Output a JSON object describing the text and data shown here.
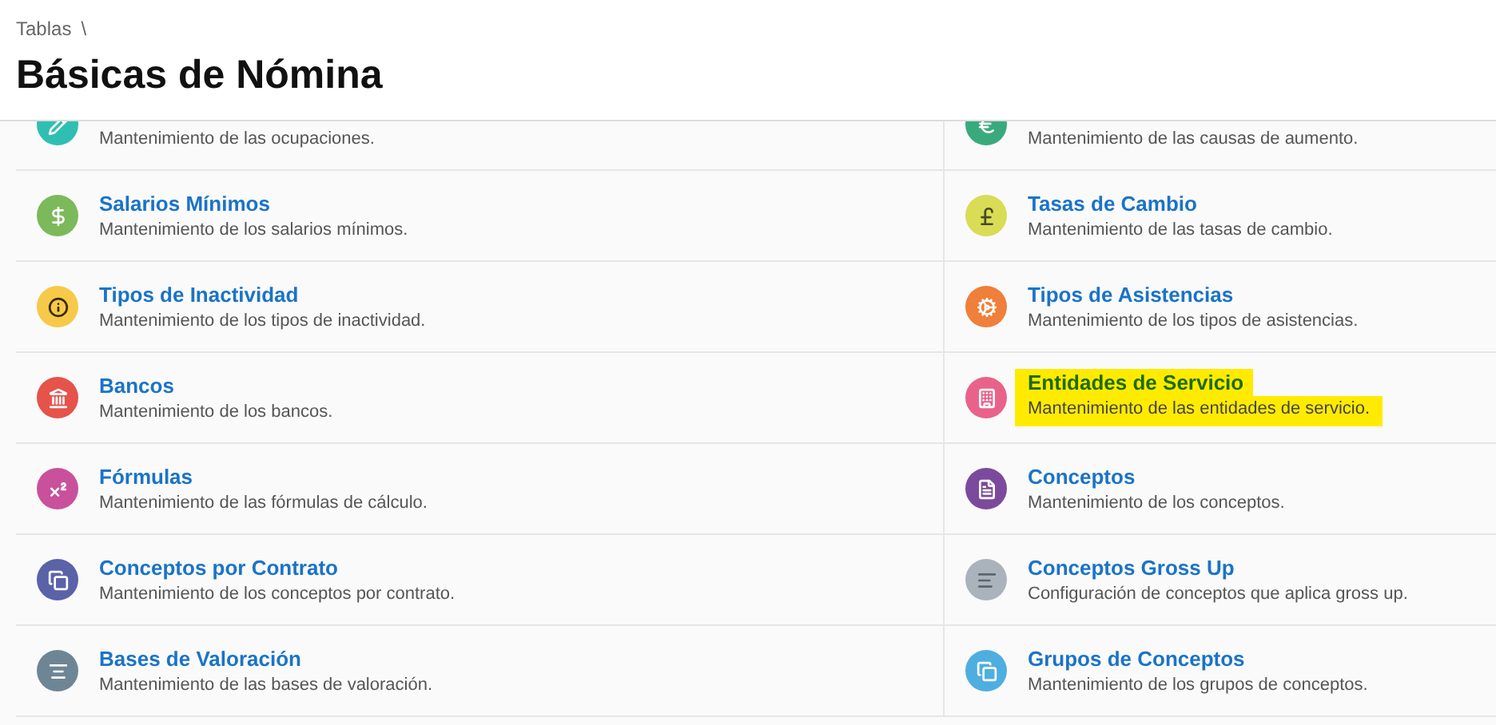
{
  "breadcrumb": {
    "items": [
      "Tablas"
    ],
    "separator": "\\"
  },
  "title": "Básicas de Nómina",
  "left_column": [
    {
      "description": "Mantenimiento de las ocupaciones.",
      "color": "#2fbfb2",
      "highlighted": false
    },
    {
      "title": "Salarios Mínimos",
      "description": "Mantenimiento de los salarios mínimos.",
      "color": "#7cb95a",
      "highlighted": false
    },
    {
      "title": "Tipos de Inactividad",
      "description": "Mantenimiento de los tipos de inactividad.",
      "color": "#f7c948",
      "highlighted": false
    },
    {
      "title": "Bancos",
      "description": "Mantenimiento de los bancos.",
      "color": "#e5534b",
      "highlighted": false
    },
    {
      "title": "Fórmulas",
      "description": "Mantenimiento de las fórmulas de cálculo.",
      "color": "#c9519b",
      "highlighted": false
    },
    {
      "title": "Conceptos por Contrato",
      "description": "Mantenimiento de los conceptos por contrato.",
      "color": "#5a62a8",
      "highlighted": false
    },
    {
      "title": "Bases de Valoración",
      "description": "Mantenimiento de las bases de valoración.",
      "color": "#6e8596",
      "highlighted": false
    }
  ],
  "right_column": [
    {
      "description": "Mantenimiento de las causas de aumento.",
      "color": "#3aaa7d",
      "highlighted": false
    },
    {
      "title": "Tasas de Cambio",
      "description": "Mantenimiento de las tasas de cambio.",
      "color": "#d9dc55",
      "highlighted": false
    },
    {
      "title": "Tipos de Asistencias",
      "description": "Mantenimiento de los tipos de asistencias.",
      "color": "#ef7f3a",
      "highlighted": false
    },
    {
      "title": "Entidades de Servicio",
      "description": "Mantenimiento de las entidades de servicio.",
      "color": "#e9628a",
      "highlighted": true
    },
    {
      "title": "Conceptos",
      "description": "Mantenimiento de los conceptos.",
      "color": "#7c4a9c",
      "highlighted": false
    },
    {
      "title": "Conceptos Gross Up",
      "description": "Configuración de conceptos que aplica gross up.",
      "color": "#aab3bb",
      "highlighted": false
    },
    {
      "title": "Grupos de Conceptos",
      "description": "Mantenimiento de los grupos de conceptos.",
      "color": "#4eaee0",
      "highlighted": false
    }
  ]
}
